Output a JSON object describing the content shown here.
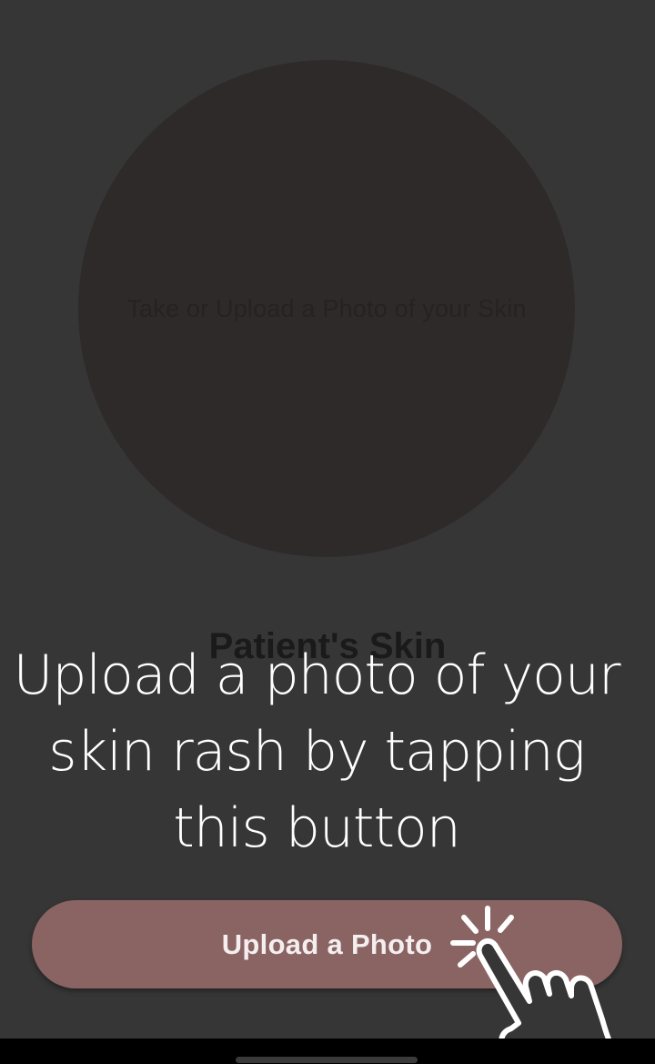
{
  "photo_area": {
    "hint": "Take or Upload a Photo of your Skin"
  },
  "section": {
    "title": "Patient's Skin"
  },
  "coach_mark": {
    "line1": "Upload a photo of your",
    "line2": "skin rash by tapping",
    "line3": "this button",
    "icon": "tap-hand-icon"
  },
  "upload_button": {
    "label": "Upload a Photo"
  },
  "colors": {
    "overlay_background": "#363636",
    "button_fill": "#8a6463",
    "coach_text": "#ffffff"
  }
}
